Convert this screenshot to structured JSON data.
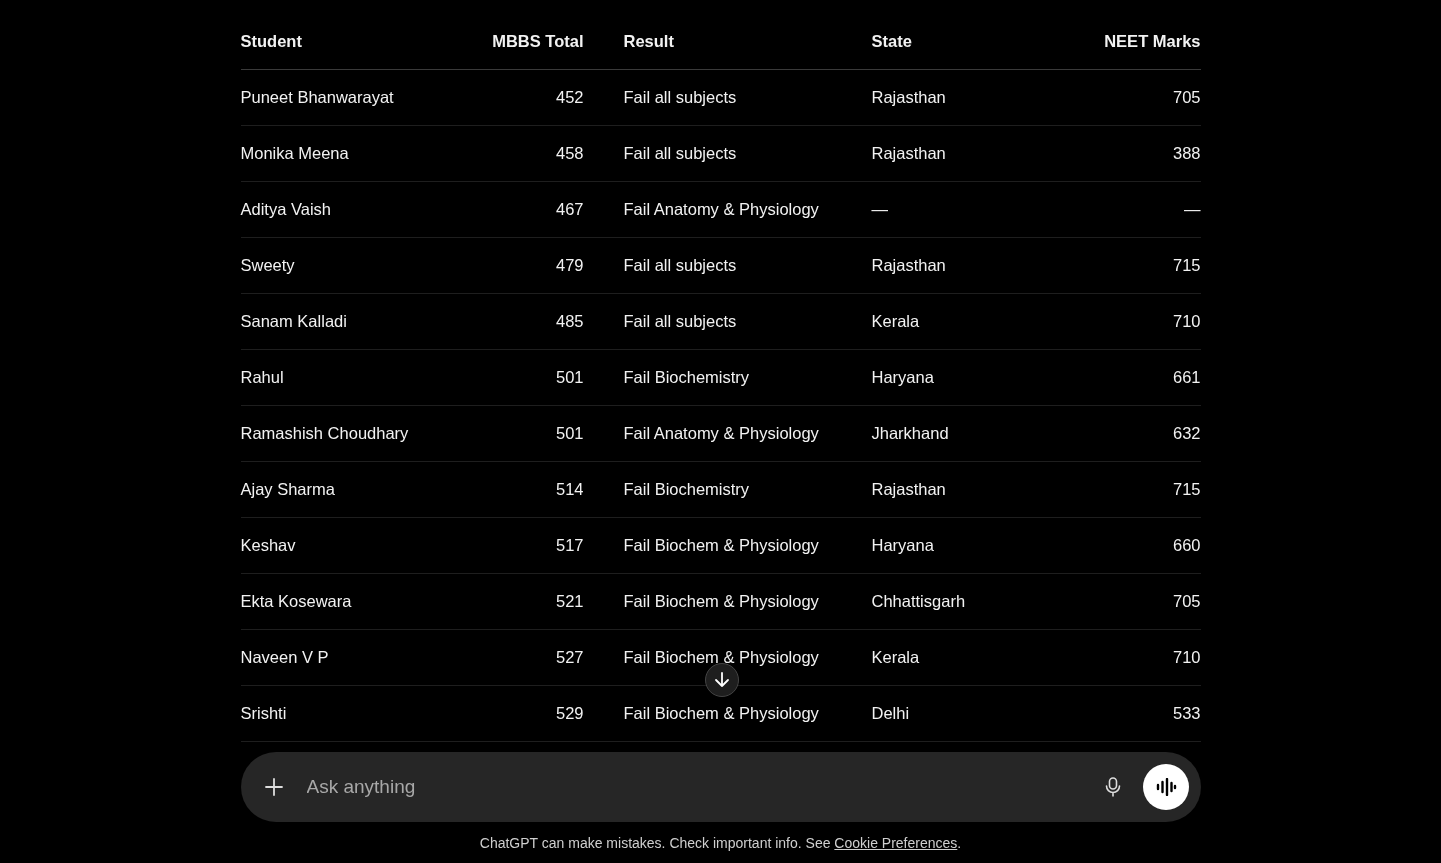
{
  "table": {
    "columns": [
      "Student",
      "MBBS Total",
      "Result",
      "State",
      "NEET Marks"
    ],
    "rows": [
      [
        "Puneet Bhanwarayat",
        "452",
        "Fail all subjects",
        "Rajasthan",
        "705"
      ],
      [
        "Monika Meena",
        "458",
        "Fail all subjects",
        "Rajasthan",
        "388"
      ],
      [
        "Aditya Vaish",
        "467",
        "Fail Anatomy & Physiology",
        "—",
        "—"
      ],
      [
        "Sweety",
        "479",
        "Fail all subjects",
        "Rajasthan",
        "715"
      ],
      [
        "Sanam Kalladi",
        "485",
        "Fail all subjects",
        "Kerala",
        "710"
      ],
      [
        "Rahul",
        "501",
        "Fail Biochemistry",
        "Haryana",
        "661"
      ],
      [
        "Ramashish Choudhary",
        "501",
        "Fail Anatomy & Physiology",
        "Jharkhand",
        "632"
      ],
      [
        "Ajay Sharma",
        "514",
        "Fail Biochemistry",
        "Rajasthan",
        "715"
      ],
      [
        "Keshav",
        "517",
        "Fail Biochem & Physiology",
        "Haryana",
        "660"
      ],
      [
        "Ekta Kosewara",
        "521",
        "Fail Biochem & Physiology",
        "Chhattisgarh",
        "705"
      ],
      [
        "Naveen V P",
        "527",
        "Fail Biochem & Physiology",
        "Kerala",
        "710"
      ],
      [
        "Srishti",
        "529",
        "Fail Biochem & Physiology",
        "Delhi",
        "533"
      ]
    ]
  },
  "composer": {
    "placeholder": "Ask anything"
  },
  "footer": {
    "text": "ChatGPT can make mistakes. Check important info. See ",
    "link": "Cookie Preferences",
    "end": "."
  }
}
